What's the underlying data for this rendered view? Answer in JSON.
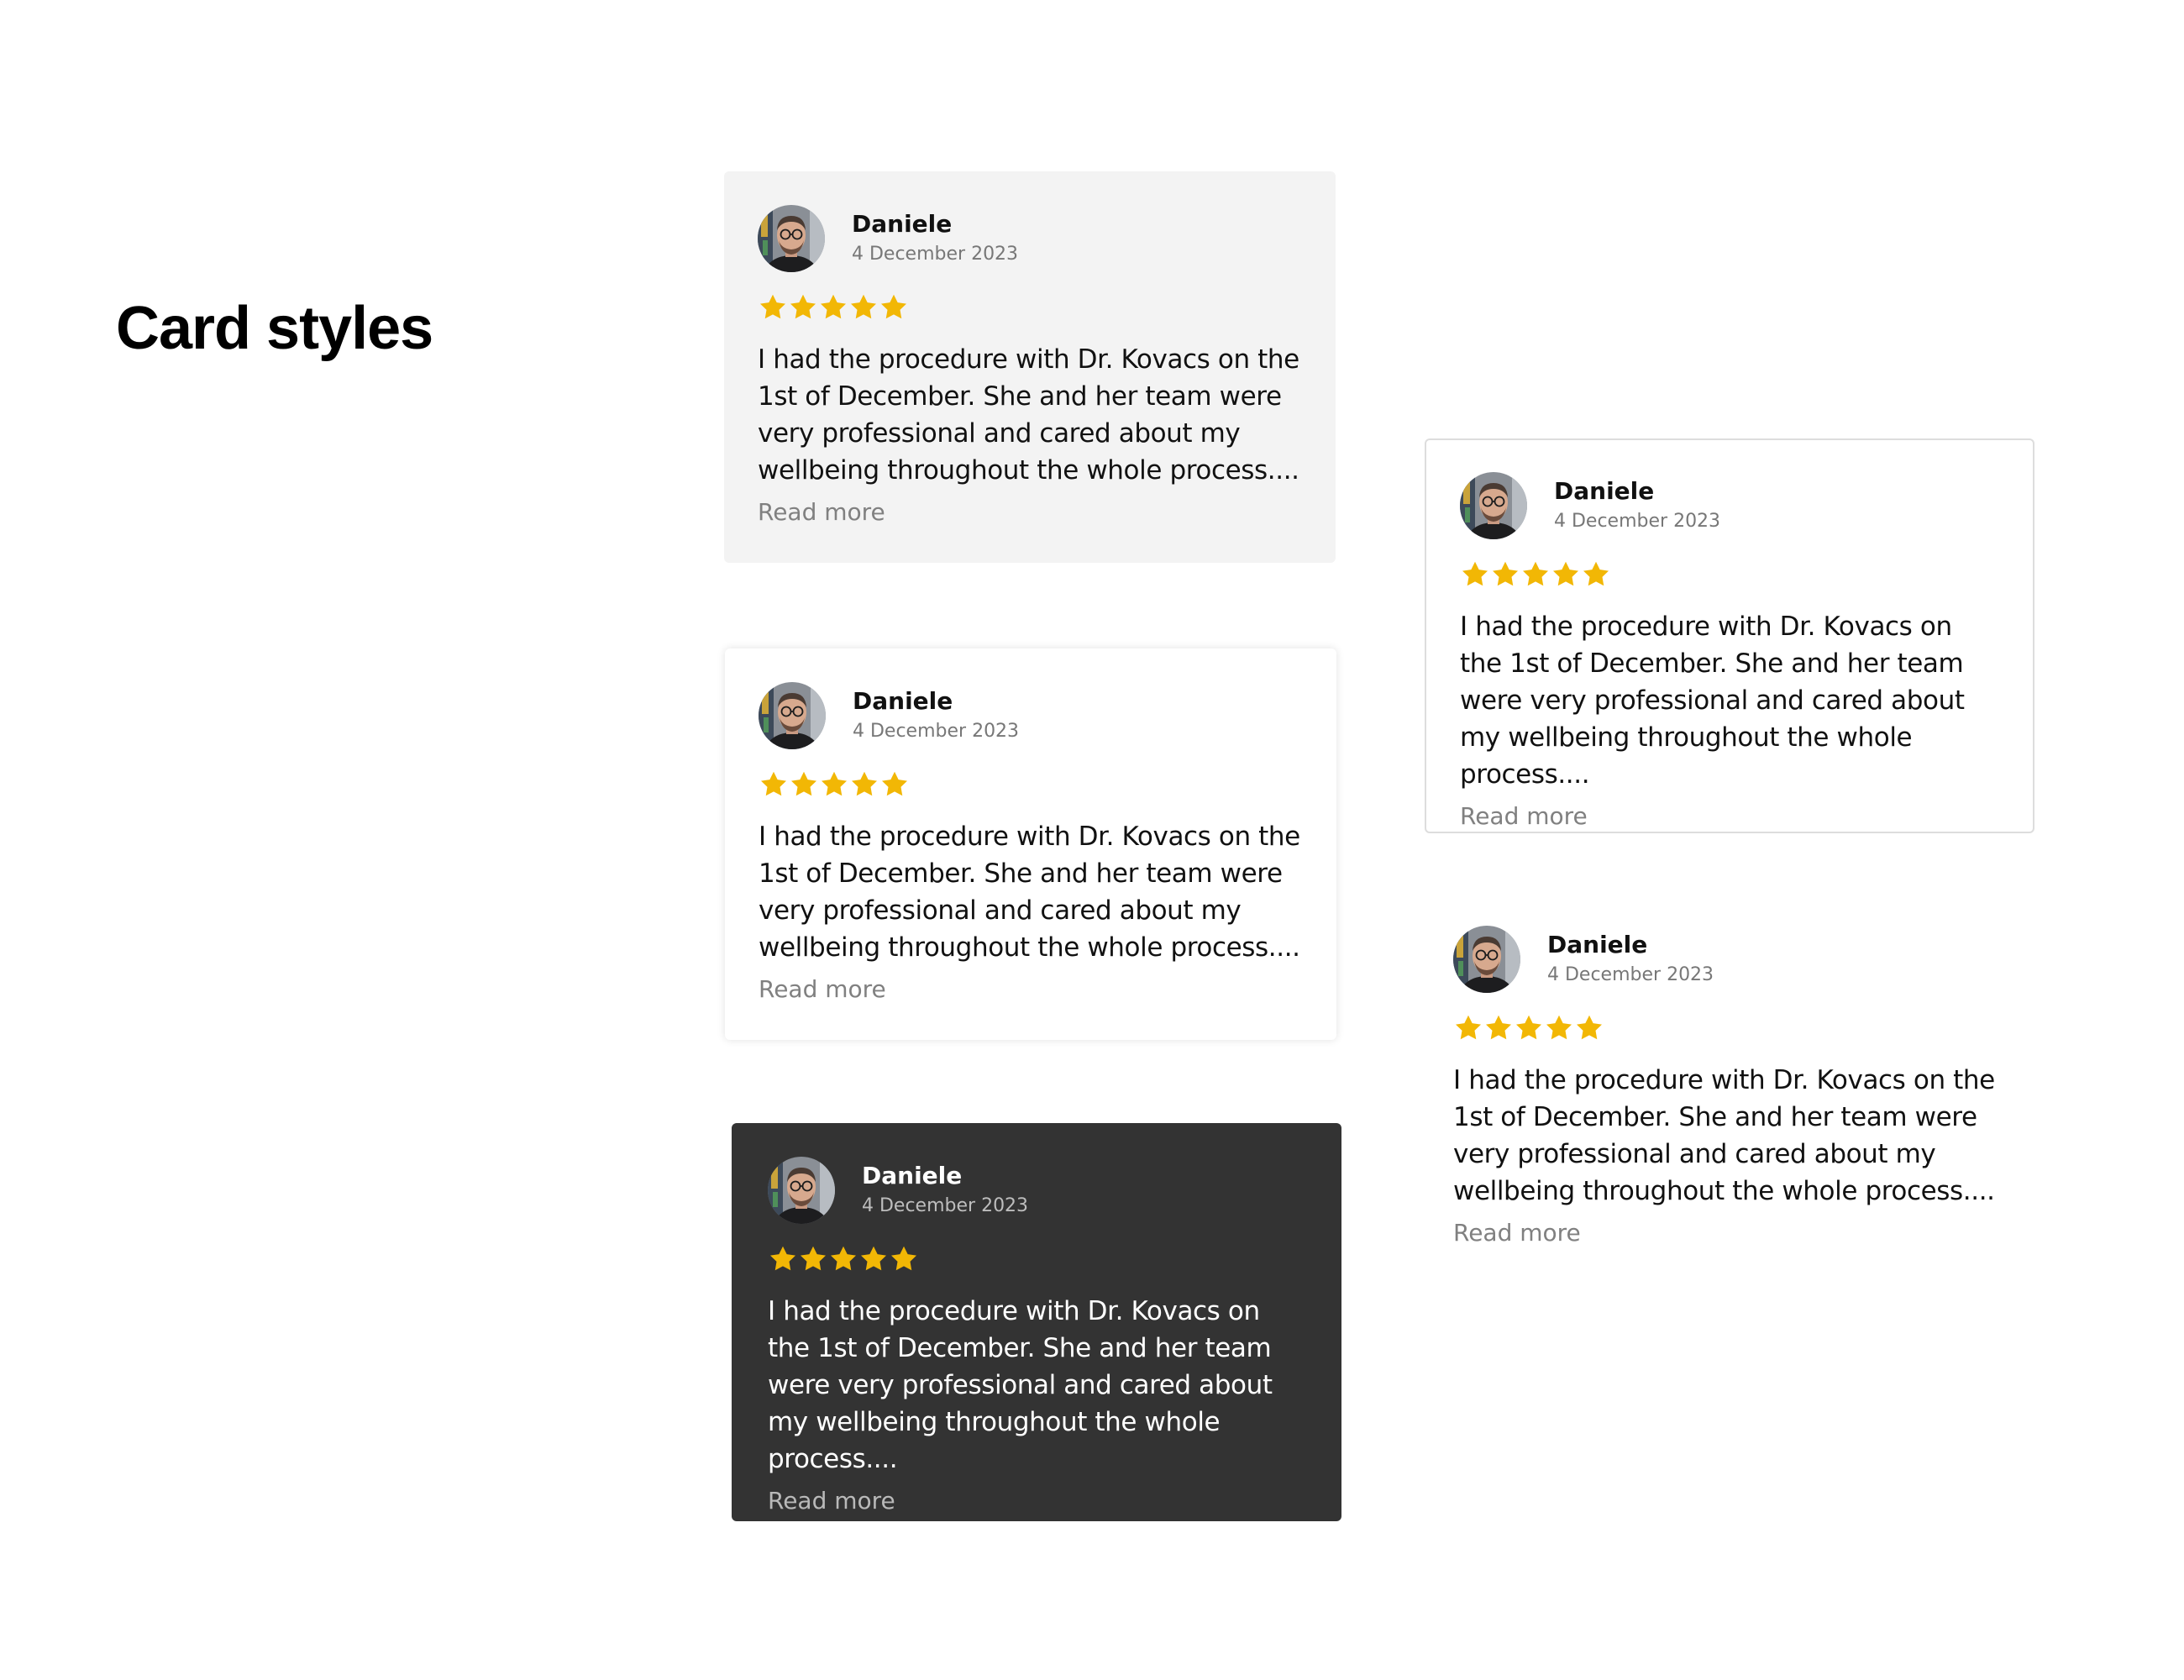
{
  "page": {
    "title": "Card styles"
  },
  "colors": {
    "star": "#F2B705",
    "filled_card_bg": "#F3F3F3",
    "dark_card_bg": "#333333",
    "outline_border": "#DDDDDD",
    "muted_text": "#808080"
  },
  "icons": {
    "star": "star-icon",
    "avatar": "avatar"
  },
  "cards": [
    {
      "style": "filled",
      "name": "Daniele",
      "date": "4 December 2023",
      "rating": 5,
      "text": "I had the procedure with Dr. Kovacs on the 1st of December. She and her team were very professional and cared about my wellbeing throughout the whole process....",
      "read_more": "Read more"
    },
    {
      "style": "shadow",
      "name": "Daniele",
      "date": "4 December 2023",
      "rating": 5,
      "text": "I had the procedure with Dr. Kovacs on the 1st of December. She and her team were very professional and cared about my wellbeing throughout the whole process....",
      "read_more": "Read more"
    },
    {
      "style": "dark",
      "name": "Daniele",
      "date": "4 December 2023",
      "rating": 5,
      "text": "I had the procedure with Dr. Kovacs on the 1st of December. She and her team were very professional and cared about my wellbeing throughout the whole process....",
      "read_more": "Read more"
    },
    {
      "style": "outline",
      "name": "Daniele",
      "date": "4 December 2023",
      "rating": 5,
      "text": "I had the procedure with Dr. Kovacs on the 1st of December. She and her team were very professional and cared about my wellbeing throughout the whole process....",
      "read_more": "Read more"
    },
    {
      "style": "plain",
      "name": "Daniele",
      "date": "4 December 2023",
      "rating": 5,
      "text": "I had the procedure with Dr. Kovacs on the 1st of December. She and her team were very professional and cared about my wellbeing throughout the whole process....",
      "read_more": "Read more"
    }
  ]
}
